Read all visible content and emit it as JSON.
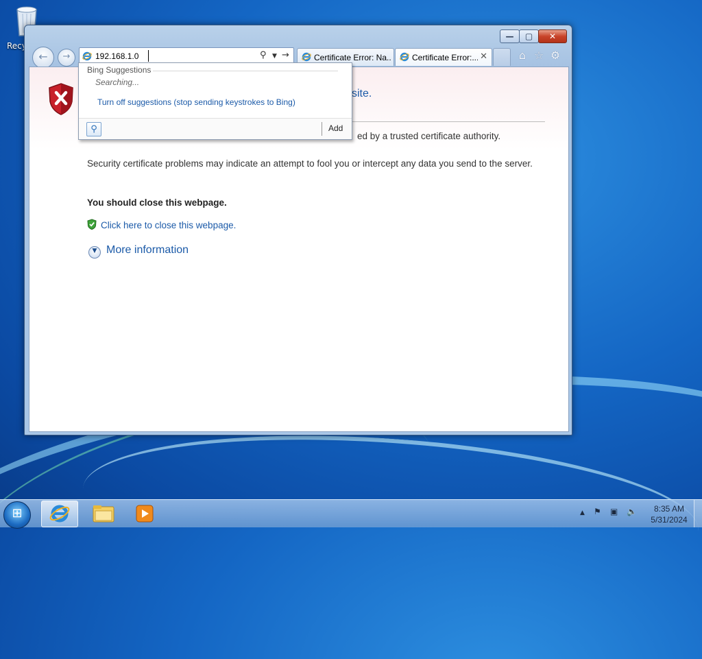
{
  "desktop": {
    "recycle_bin_label": "Recy"
  },
  "browser": {
    "address": {
      "value": "192.168.1.0",
      "search_icon": "search-icon",
      "dropdown_icon": "chevron-down-icon",
      "go_icon": "go-arrow-icon"
    },
    "tabs": [
      {
        "title": "Certificate Error: Na..."
      },
      {
        "title": "Certificate Error:...",
        "close": "✕"
      }
    ],
    "toolbar_icons": [
      "home-icon",
      "favorites-star-icon",
      "settings-gear-icon"
    ]
  },
  "suggestions": {
    "header": "Bing Suggestions",
    "status": "Searching...",
    "turn_off": "Turn off suggestions (stop sending keystrokes to Bing)",
    "add_label": "Add"
  },
  "page": {
    "title_fragment": "site.",
    "line1_fragment": "ed by a trusted certificate authority.",
    "line2": "Security certificate problems may indicate an attempt to fool you or intercept any data you send to the server.",
    "advice": "You should close this webpage.",
    "close_link": "Click here to close this webpage.",
    "more_info": "More information"
  },
  "taskbar": {
    "time": "8:35 AM",
    "date": "5/31/2024",
    "tray_expand": "▲"
  },
  "colors": {
    "link": "#1b5aa8",
    "close_button": "#c8442a"
  }
}
